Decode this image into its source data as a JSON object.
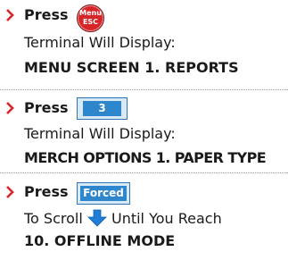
{
  "colors": {
    "bullet": "#d6262a",
    "key_blue": "#2e86cc",
    "menu_key_red": "#d6262a",
    "arrow_blue": "#1f7fd6",
    "text": "#1a1a1a"
  },
  "steps": [
    {
      "press_label": "Press",
      "key": {
        "type": "menu-esc-key",
        "line1": "Menu",
        "line2": "ESC"
      },
      "line1": "Terminal Will Display:",
      "line2": "MENU SCREEN  1. REPORTS"
    },
    {
      "press_label": "Press",
      "key": {
        "type": "number-key",
        "label": "3"
      },
      "line1": "Terminal Will Display:",
      "line2": "MERCH OPTIONS  1. PAPER TYPE"
    },
    {
      "press_label": "Press",
      "key": {
        "type": "forced-key",
        "label": "Forced"
      },
      "line1_before": "To Scroll",
      "line1_icon": "down-arrow-icon",
      "line1_after": "Until You Reach",
      "line2": "10. OFFLINE MODE"
    }
  ]
}
